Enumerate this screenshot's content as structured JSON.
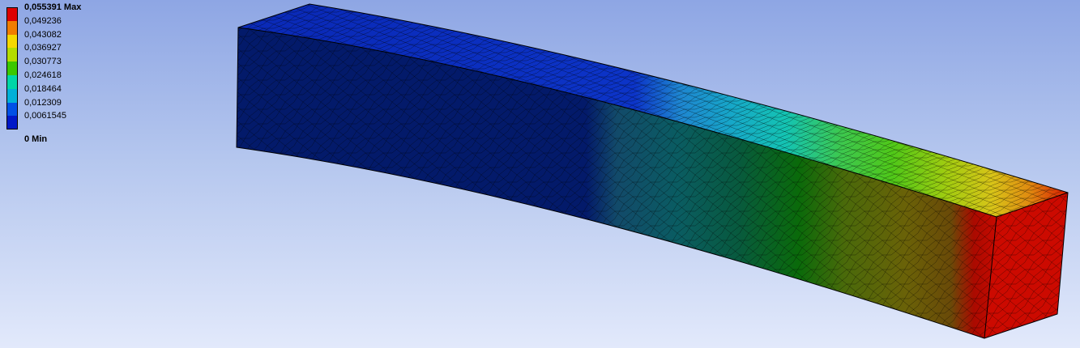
{
  "legend": {
    "max_value": "0,055391",
    "max_suffix": "Max",
    "labels": [
      "0,055391 Max",
      "0,049236",
      "0,043082",
      "0,036927",
      "0,030773",
      "0,024618",
      "0,018464",
      "0,012309",
      "0,0061545"
    ],
    "min_label": "0 Min",
    "colors": [
      "#dd0000",
      "#f07d00",
      "#f5d800",
      "#b4dc00",
      "#3cc800",
      "#00d6a8",
      "#00b0d8",
      "#0050e6",
      "#0018c8"
    ]
  },
  "model": {
    "result_min": 0,
    "result_max": 0.055391,
    "mesh_color": "#000000"
  }
}
